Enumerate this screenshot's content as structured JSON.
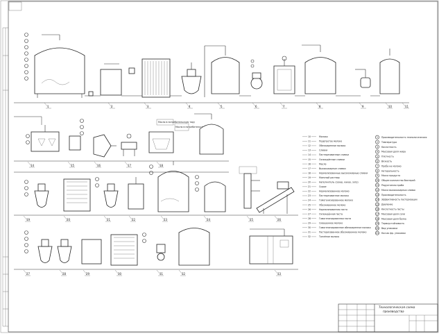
{
  "title_block": {
    "title_line1": "Технологическая схема",
    "title_line2": "производства"
  },
  "legend_left": [
    {
      "code": "10",
      "label": "Молоко"
    },
    {
      "code": "11",
      "label": "Подогретое молоко"
    },
    {
      "code": "12",
      "label": "Обезжиренное молоко"
    },
    {
      "code": "13",
      "label": "Сливки"
    },
    {
      "code": "14",
      "label": "Пастеризованные сливки"
    },
    {
      "code": "15",
      "label": "Охлаждённые сливки"
    },
    {
      "code": "16",
      "label": "Масло"
    },
    {
      "code": "17",
      "label": "Высокожирные сливки"
    },
    {
      "code": "18",
      "label": "Нормализованные высокожирные сливки"
    },
    {
      "code": "19",
      "label": "Моечный раствор"
    },
    {
      "code": "20",
      "label": "Наполнитель (сахар, какао, затр)"
    },
    {
      "code": "21",
      "label": "Сырье"
    },
    {
      "code": "22",
      "label": "Нормализованное молоко"
    },
    {
      "code": "23",
      "label": "Пастеризованное молоко"
    },
    {
      "code": "24",
      "label": "Гомогенизированное молоко"
    },
    {
      "code": "25",
      "label": "Обезжиренное молоко"
    },
    {
      "code": "26",
      "label": "Нормализованная паста"
    },
    {
      "code": "27",
      "label": "Охлаждённая паста"
    },
    {
      "code": "28",
      "label": "Гомогенизированная паста"
    },
    {
      "code": "29",
      "label": "Сквашенное молоко"
    },
    {
      "code": "30",
      "label": "Гомогенизированное обезжиренное молоко"
    },
    {
      "code": "31",
      "label": "Пастеризованное обезжиренное молоко"
    },
    {
      "code": "32",
      "label": "Топлёное молоко"
    }
  ],
  "legend_right": [
    {
      "num": "1",
      "label": "Производительность технологическая"
    },
    {
      "num": "2",
      "label": "Температура"
    },
    {
      "num": "3",
      "label": "Кислотность"
    },
    {
      "num": "4",
      "label": "Массовая доля жира"
    },
    {
      "num": "5",
      "label": "Плотность"
    },
    {
      "num": "6",
      "label": "Вязкость"
    },
    {
      "num": "7",
      "label": "Проба на молоко"
    },
    {
      "num": "8",
      "label": "Натуральность"
    },
    {
      "num": "9",
      "label": "Масса продукта"
    },
    {
      "num": "10",
      "label": "Общее количество бактерий"
    },
    {
      "num": "11",
      "label": "Редуктазная проба"
    },
    {
      "num": "12",
      "label": "Масса высокожирных сливок"
    },
    {
      "num": "13",
      "label": "Производительность"
    },
    {
      "num": "14",
      "label": "Эффективность пастеризации"
    },
    {
      "num": "15",
      "label": "Давление"
    },
    {
      "num": "16",
      "label": "Кислотность пасты"
    },
    {
      "num": "17",
      "label": "Массовая доля соли"
    },
    {
      "num": "18",
      "label": "Массовая доля белка"
    },
    {
      "num": "19",
      "label": "Термоустойчивость"
    },
    {
      "num": "20",
      "label": "Вид упаковки"
    },
    {
      "num": "21",
      "label": "Кол-во фр. упаковки"
    }
  ],
  "equipment_numbers": {
    "row1": [
      "1",
      "2",
      "3",
      "4",
      "5",
      "6",
      "7",
      "8",
      "9",
      "10",
      "11"
    ],
    "row2": [
      "14",
      "15",
      "16",
      "17",
      "18"
    ],
    "row3": [
      "19",
      "20",
      "21",
      "22",
      "23",
      "24",
      "25",
      "26"
    ],
    "row4": [
      "27",
      "28",
      "29",
      "30",
      "31",
      "32",
      "33"
    ]
  },
  "callouts": {
    "row2_a": "Масло в потребительскую тару",
    "row2_b": "Масло в потребительскую тару"
  }
}
